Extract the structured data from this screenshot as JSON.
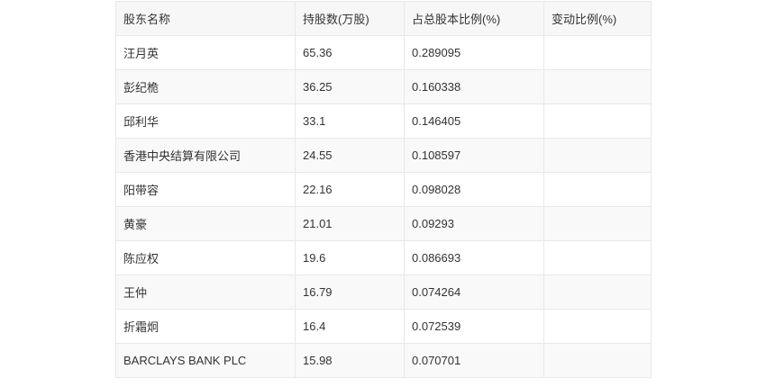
{
  "table": {
    "headers": [
      "股东名称",
      "持股数(万股)",
      "占总股本比例(%)",
      "变动比例(%)"
    ],
    "rows": [
      {
        "name": "汪月英",
        "shares": "65.36",
        "ratio": "0.289095",
        "change": ""
      },
      {
        "name": "彭纪桅",
        "shares": "36.25",
        "ratio": "0.160338",
        "change": ""
      },
      {
        "name": "邱利华",
        "shares": "33.1",
        "ratio": "0.146405",
        "change": ""
      },
      {
        "name": "香港中央结算有限公司",
        "shares": "24.55",
        "ratio": "0.108597",
        "change": ""
      },
      {
        "name": "阳带容",
        "shares": "22.16",
        "ratio": "0.098028",
        "change": ""
      },
      {
        "name": "黄豪",
        "shares": "21.01",
        "ratio": "0.09293",
        "change": ""
      },
      {
        "name": "陈应权",
        "shares": "19.6",
        "ratio": "0.086693",
        "change": ""
      },
      {
        "name": "王仲",
        "shares": "16.79",
        "ratio": "0.074264",
        "change": ""
      },
      {
        "name": "折霜炯",
        "shares": "16.4",
        "ratio": "0.072539",
        "change": ""
      },
      {
        "name": "BARCLAYS BANK PLC",
        "shares": "15.98",
        "ratio": "0.070701",
        "change": ""
      }
    ]
  }
}
